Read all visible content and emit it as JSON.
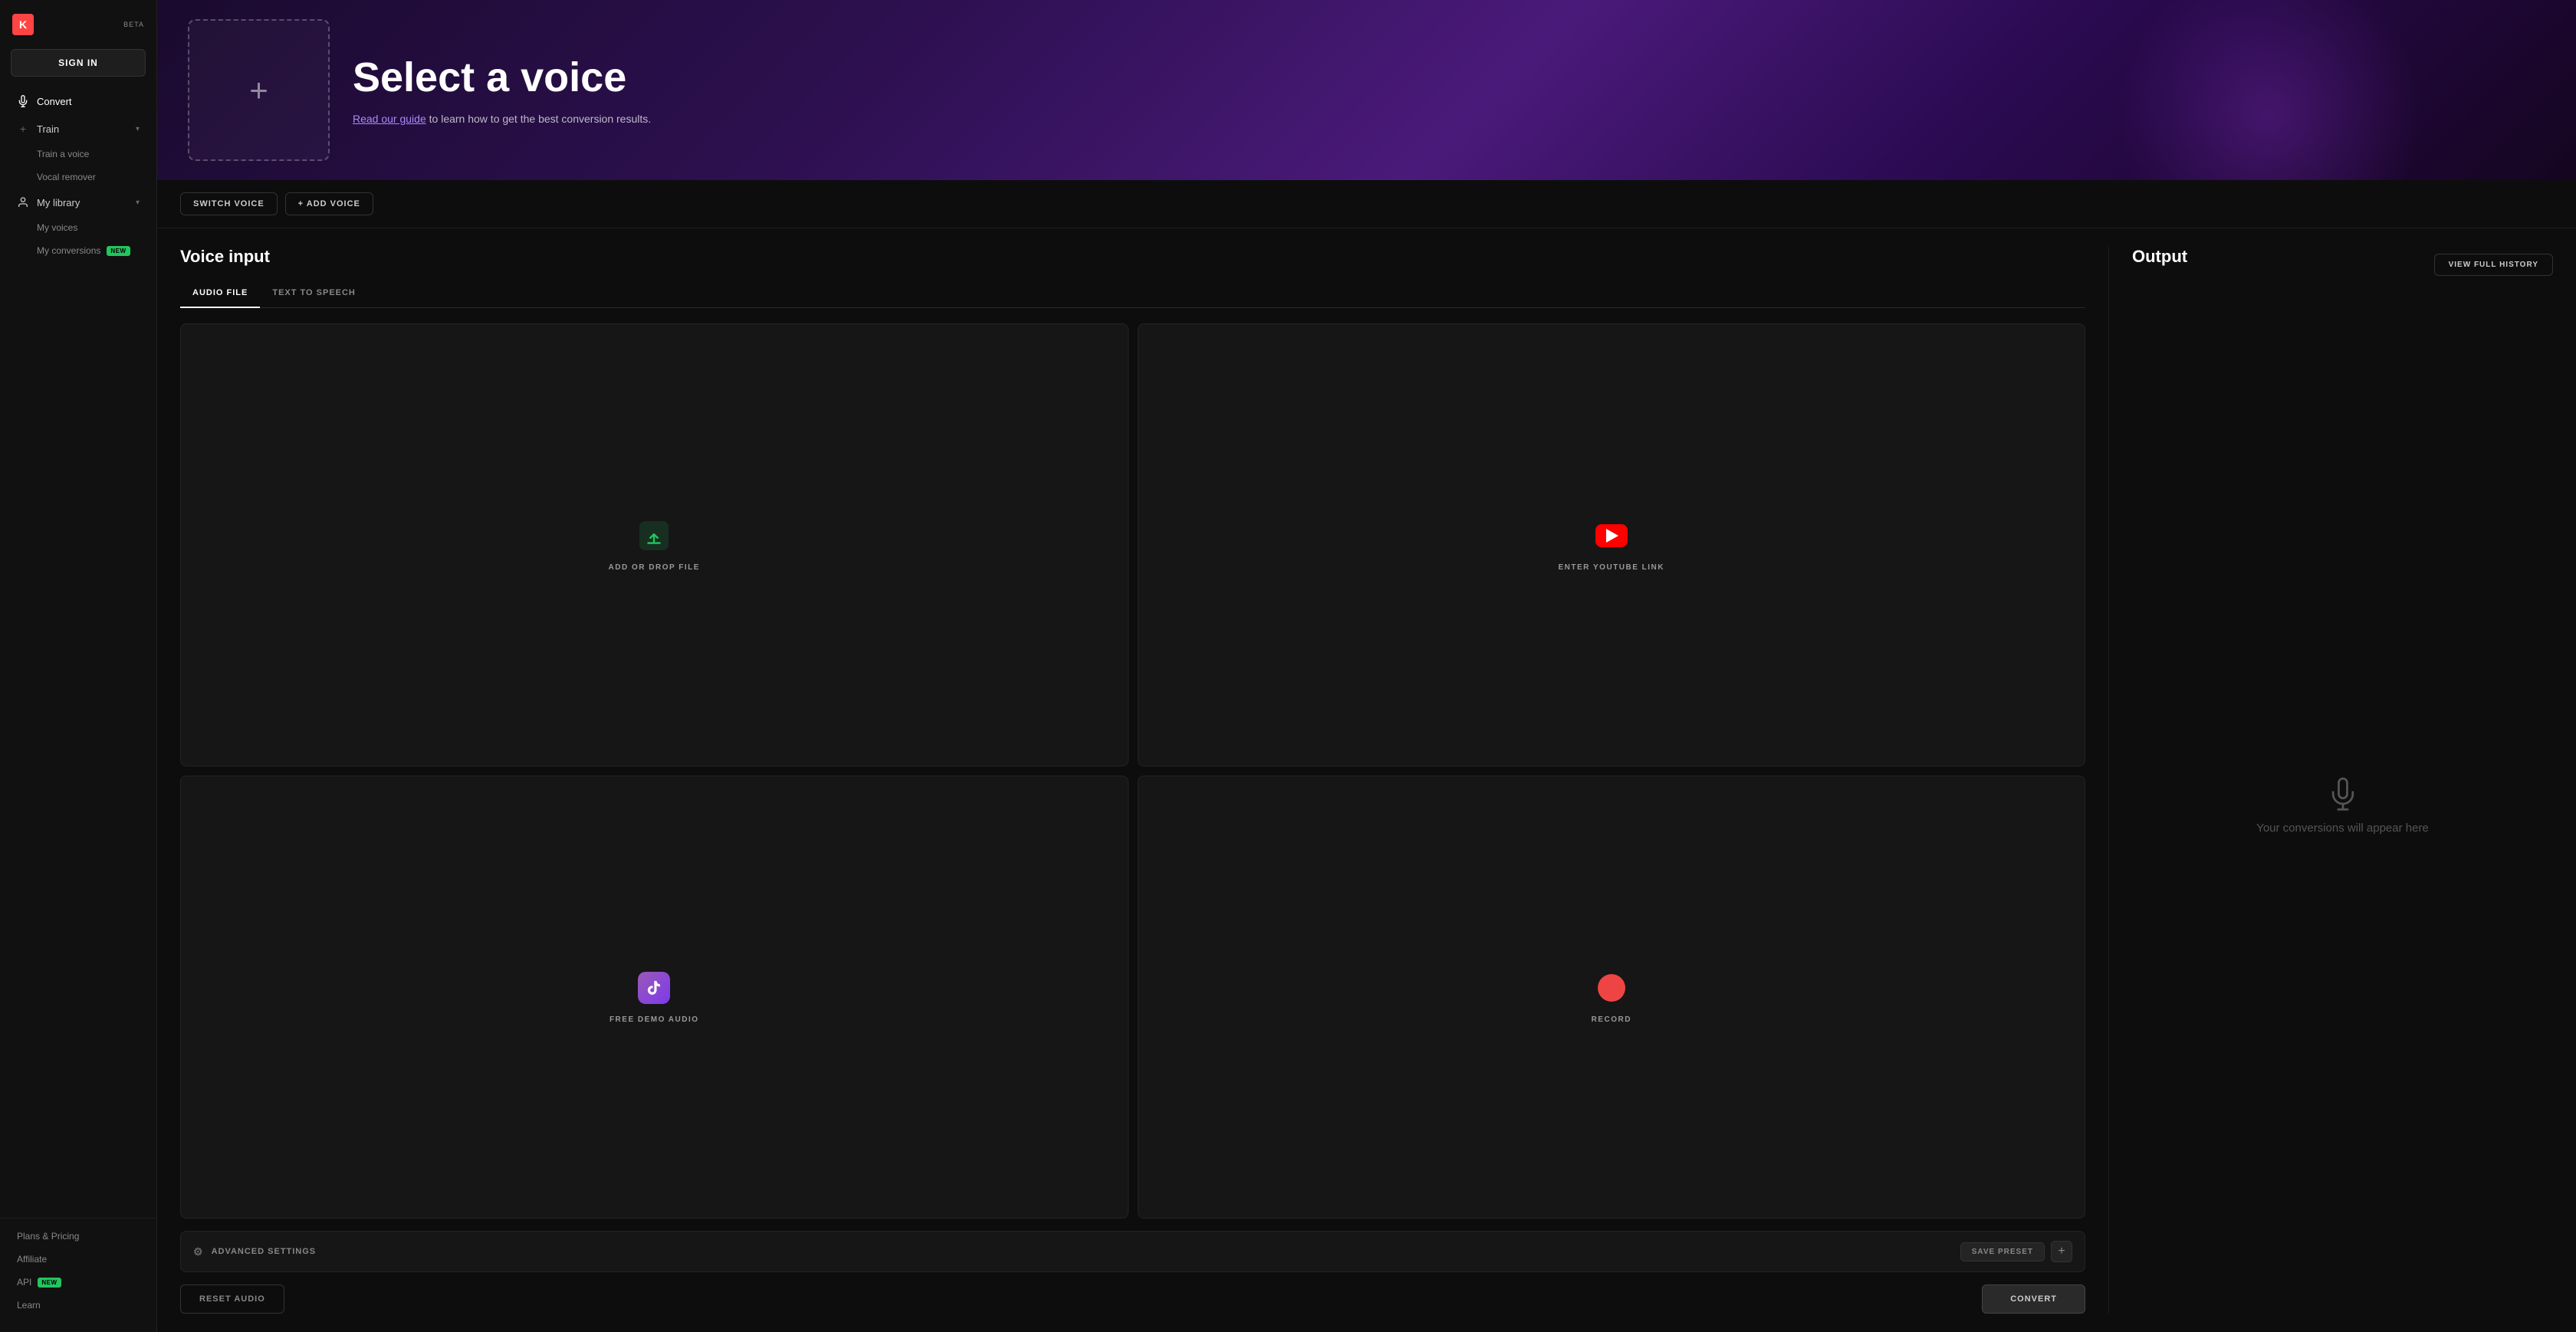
{
  "app": {
    "logo_text": "K",
    "beta_label": "BETA",
    "sign_in_label": "SIGN IN"
  },
  "sidebar": {
    "nav_items": [
      {
        "id": "convert",
        "label": "Convert",
        "icon": "mic-icon",
        "has_chevron": false,
        "active": true
      },
      {
        "id": "train",
        "label": "Train",
        "icon": "plus-icon",
        "has_chevron": true,
        "active": false
      }
    ],
    "train_subitems": [
      {
        "id": "train-a-voice",
        "label": "Train a voice"
      },
      {
        "id": "vocal-remover",
        "label": "Vocal remover"
      }
    ],
    "library_item": {
      "label": "My library",
      "icon": "person-icon",
      "has_chevron": true
    },
    "library_subitems": [
      {
        "id": "my-voices",
        "label": "My voices",
        "has_new": false
      },
      {
        "id": "my-conversions",
        "label": "My conversions",
        "has_new": true
      }
    ],
    "bottom_items": [
      {
        "id": "plans-pricing",
        "label": "Plans & Pricing"
      },
      {
        "id": "affiliate",
        "label": "Affiliate"
      },
      {
        "id": "api",
        "label": "API",
        "has_new": true
      },
      {
        "id": "learn",
        "label": "Learn"
      }
    ]
  },
  "hero": {
    "title": "Select a voice",
    "subtitle_text": " to learn how to get the best conversion results.",
    "guide_link_text": "Read our guide",
    "placeholder_plus": "+"
  },
  "actions_bar": {
    "switch_voice_label": "SWITCH VOICE",
    "add_voice_label": "+ ADD VOICE"
  },
  "voice_input": {
    "panel_title": "Voice input",
    "tabs": [
      {
        "id": "audio-file",
        "label": "AUDIO FILE",
        "active": true
      },
      {
        "id": "text-to-speech",
        "label": "TEXT TO SPEECH",
        "active": false
      }
    ],
    "input_cards": [
      {
        "id": "add-drop-file",
        "label": "ADD OR DROP FILE",
        "icon_type": "upload"
      },
      {
        "id": "youtube-link",
        "label": "ENTER YOUTUBE LINK",
        "icon_type": "youtube"
      },
      {
        "id": "free-demo-audio",
        "label": "FREE DEMO AUDIO",
        "icon_type": "tiktok"
      },
      {
        "id": "record",
        "label": "RECORD",
        "icon_type": "record"
      }
    ],
    "advanced_settings_label": "ADVANCED SETTINGS",
    "save_preset_label": "SAVE PRESET",
    "reset_audio_label": "RESET AUDIO",
    "convert_label": "CONVERT"
  },
  "output": {
    "panel_title": "Output",
    "view_history_label": "VIEW FULL HISTORY",
    "empty_message": "Your conversions will appear here"
  },
  "new_badge_text": "NEW"
}
